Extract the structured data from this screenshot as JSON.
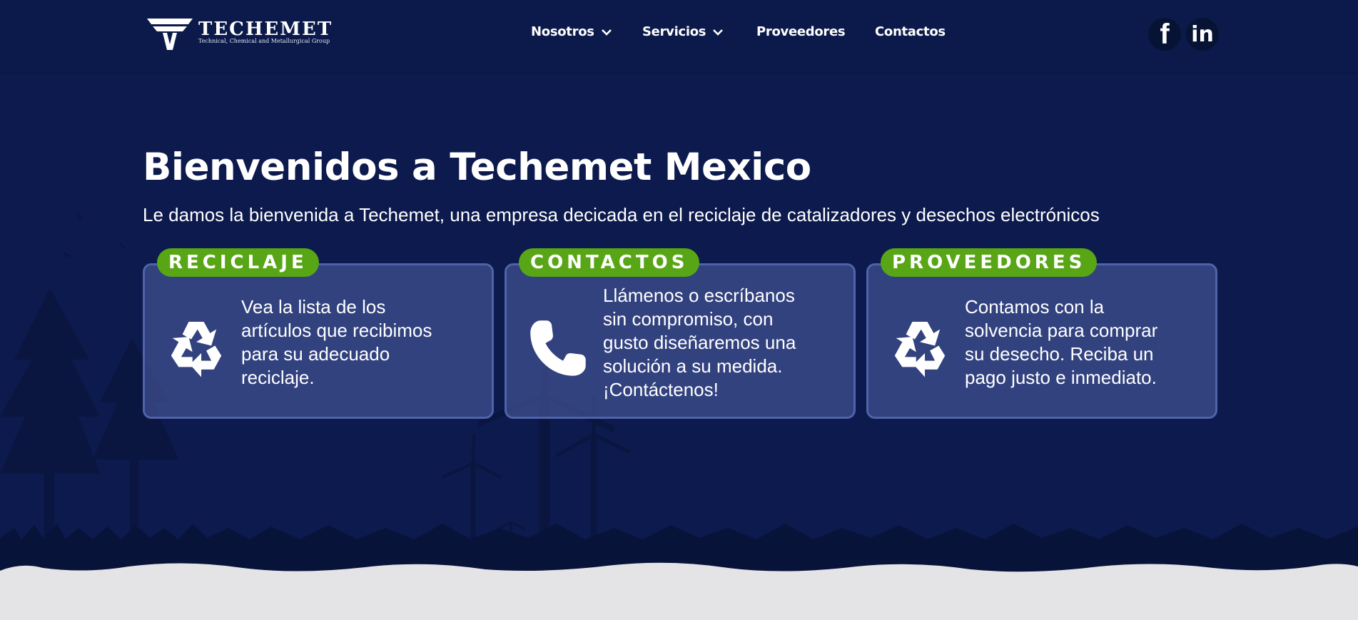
{
  "brand": {
    "name": "TECHEMET",
    "tagline": "Technical, Chemical and Metallurgical Group"
  },
  "nav": {
    "items": [
      {
        "label": "Nosotros",
        "has_dropdown": true
      },
      {
        "label": "Servicios",
        "has_dropdown": true
      },
      {
        "label": "Proveedores",
        "has_dropdown": false
      },
      {
        "label": "Contactos",
        "has_dropdown": false
      }
    ]
  },
  "social": {
    "facebook": {
      "icon": "facebook-icon",
      "glyph": "f"
    },
    "linkedin": {
      "icon": "linkedin-icon",
      "glyph": "in"
    }
  },
  "hero": {
    "title": "Bienvenidos a Techemet Mexico",
    "subtitle": "Le damos la bienvenida a Techemet, una empresa decicada en el reciclaje de catalizadores y desechos electrónicos"
  },
  "cards": [
    {
      "tag": "RECICLAJE",
      "icon": "recycle-icon",
      "lines": [
        "Vea la lista de los",
        "artículos que recibimos",
        "para su adecuado",
        "reciclaje."
      ]
    },
    {
      "tag": "CONTACTOS",
      "icon": "phone-icon",
      "lines": [
        "Llámenos o escríbanos",
        "sin compromiso, con",
        "gusto diseñaremos una",
        "solución a su medida.",
        "¡Contáctenos!"
      ]
    },
    {
      "tag": "PROVEEDORES",
      "icon": "recycle-icon",
      "lines": [
        "Contamos con la",
        "solvencia para comprar",
        "su desecho. Reciba un",
        "pago justo e inmediato."
      ]
    }
  ],
  "colors": {
    "header_bg": "#0b1a4a",
    "hero_bg": "#0c1a4d",
    "card_bg": "#3a4989",
    "tag_green": "#58a616",
    "bottom_band": "#e4e4e6"
  }
}
